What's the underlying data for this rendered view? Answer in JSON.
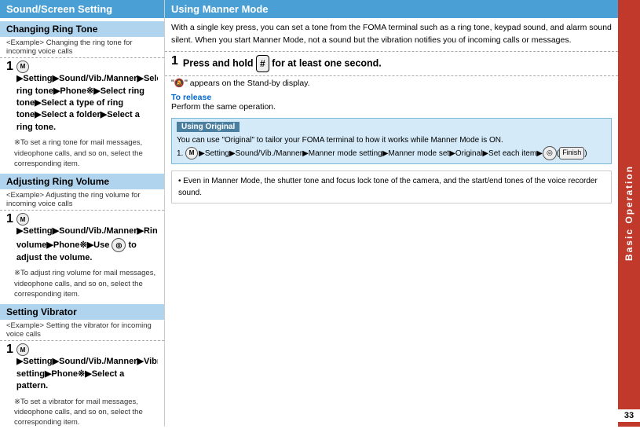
{
  "left": {
    "main_header": "Sound/Screen Setting",
    "sections": [
      {
        "header": "Changing Ring Tone",
        "example": "<Example> Changing the ring tone for incoming voice calls",
        "step_num": "1",
        "step_html": "▶Setting▶Sound/Vib./Manner▶Select ring tone▶Phone※▶Select ring tone▶Select a type of ring tone▶Select a folder▶Select a ring tone.",
        "note": "※To set a ring tone for mail messages, videophone calls, and so on, select the corresponding item."
      },
      {
        "header": "Adjusting Ring Volume",
        "example": "<Example> Adjusting the ring volume for incoming voice calls",
        "step_num": "1",
        "step_html": "▶Setting▶Sound/Vib./Manner▶Ring volume▶Phone※▶Use  to adjust the volume.",
        "note": "※To adjust ring volume for mail messages, videophone calls, and so on, select the corresponding item."
      },
      {
        "header": "Setting Vibrator",
        "example": "<Example> Setting the vibrator for incoming voice calls",
        "step_num": "1",
        "step_html": "▶Setting▶Sound/Vib./Manner▶Vibrator setting▶Phone※▶Select a pattern.",
        "note": "※To set a vibrator for mail messages, videophone calls, and so on, select the corresponding item."
      }
    ]
  },
  "right": {
    "header": "Using Manner Mode",
    "intro": "With a single key press, you can set a tone from the FOMA terminal such as a ring tone, keypad sound, and alarm sound silent. When you start Manner Mode, not a sound but the vibration notifies you of incoming calls or messages.",
    "step_num": "1",
    "step_text": "Press and hold   for at least one second.",
    "step_sub": "\" \" appears on the Stand-by display.",
    "to_release_label": "To release",
    "to_release_text": "Perform the same operation.",
    "using_original": {
      "header": "Using Original",
      "body_text": "You can use \"Original\" to tailor your FOMA terminal to how it works while Manner Mode is ON.",
      "step": "1. ▶Setting▶Sound/Vib./Manner▶Manner mode setting▶Manner mode set▶Original▶Set each item▶(Finish)"
    },
    "bullet_note": "• Even in Manner Mode, the shutter tone and focus lock tone of the camera, and the start/end tones of the voice recorder sound."
  },
  "sidebar": {
    "text": "Basic  Operation",
    "page_number": "33"
  }
}
